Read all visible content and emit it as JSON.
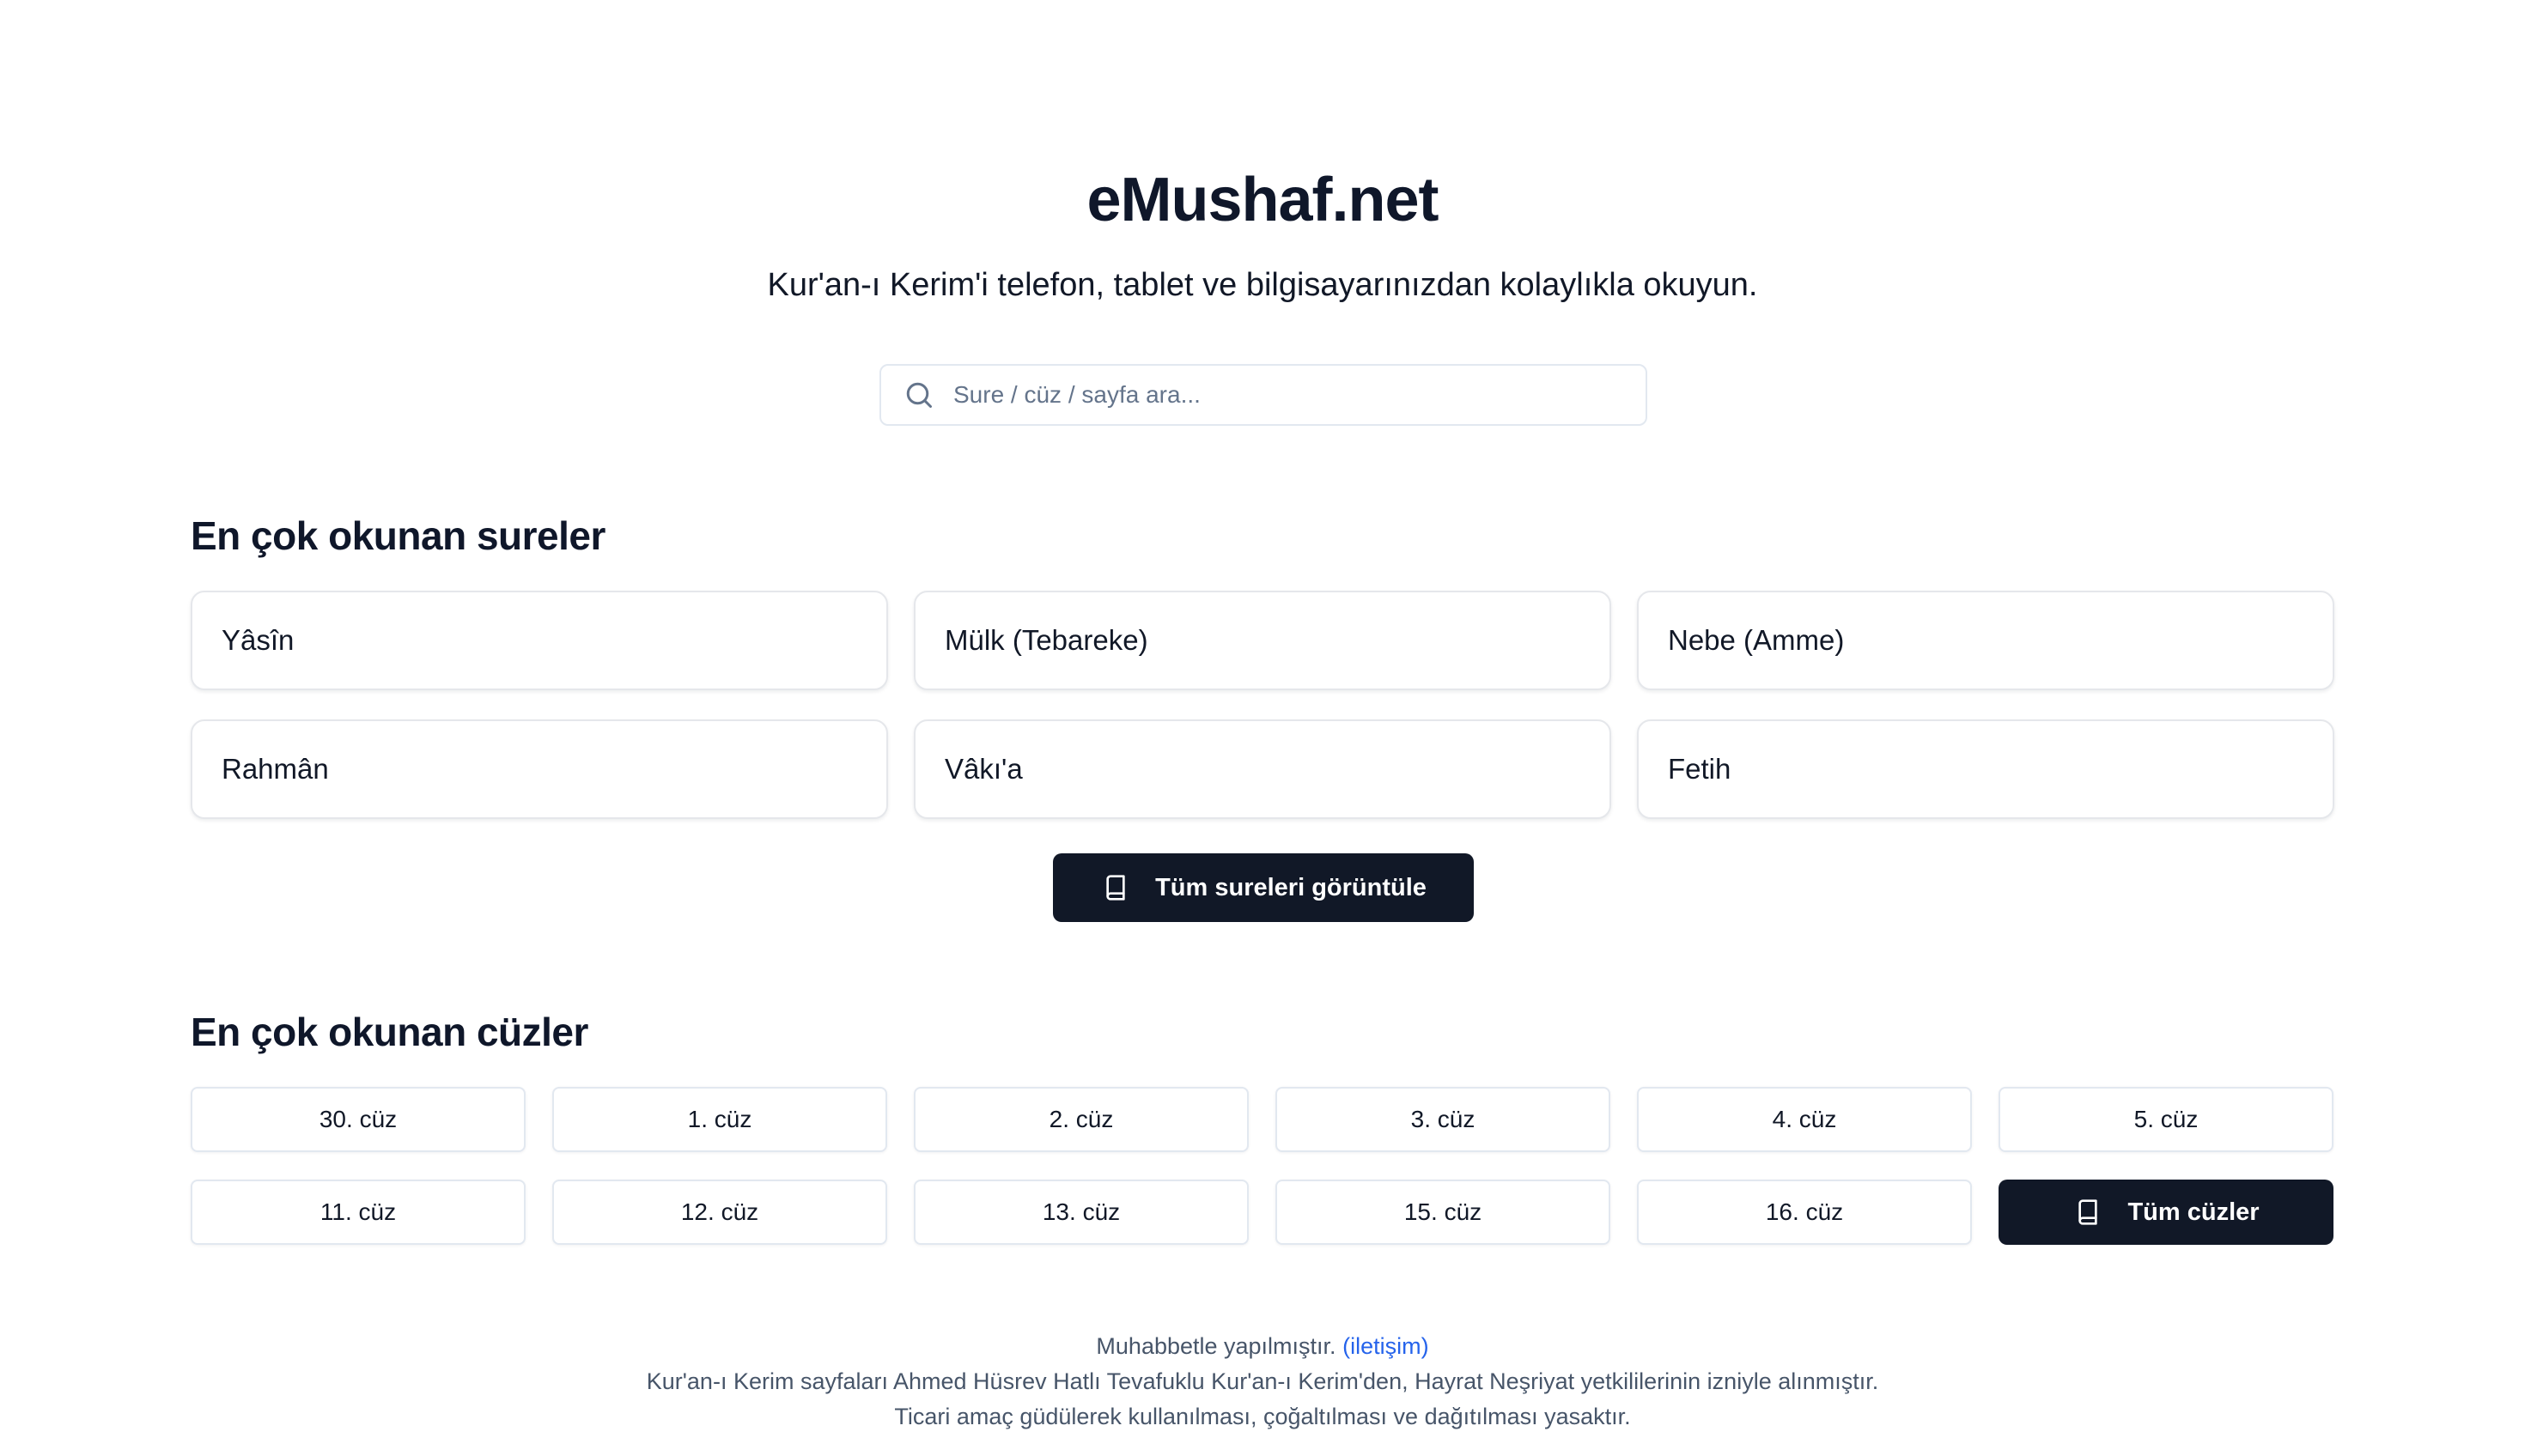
{
  "header": {
    "title": "eMushaf.net",
    "subtitle": "Kur'an-ı Kerim'i telefon, tablet ve bilgisayarınızdan kolaylıkla okuyun."
  },
  "search": {
    "placeholder": "Sure / cüz / sayfa ara...",
    "value": "",
    "icon": "search-icon"
  },
  "sureler": {
    "title": "En çok okunan sureler",
    "items": [
      "Yâsîn",
      "Mülk (Tebareke)",
      "Nebe (Amme)",
      "Rahmân",
      "Vâkı'a",
      "Fetih"
    ],
    "all_button_label": "Tüm sureleri görüntüle",
    "all_button_icon": "book-icon"
  },
  "cuzler": {
    "title": "En çok okunan cüzler",
    "items": [
      "30. cüz",
      "1. cüz",
      "2. cüz",
      "3. cüz",
      "4. cüz",
      "5. cüz",
      "11. cüz",
      "12. cüz",
      "13. cüz",
      "15. cüz",
      "16. cüz"
    ],
    "all_button_label": "Tüm cüzler",
    "all_button_icon": "book-icon"
  },
  "footer": {
    "line1_text": "Muhabbetle yapılmıştır.",
    "contact_link": "(iletişim)",
    "line2": "Kur'an-ı Kerim sayfaları Ahmed Hüsrev Hatlı Tevafuklu Kur'an-ı Kerim'den, Hayrat Neşriyat yetkililerinin izniyle alınmıştır.",
    "line3": "Ticari amaç güdülerek kullanılması, çoğaltılması ve dağıtılması yasaktır."
  },
  "colors": {
    "primary_dark": "#111827",
    "link": "#2563eb",
    "muted_text": "#475569",
    "border": "#e2e8f0"
  }
}
